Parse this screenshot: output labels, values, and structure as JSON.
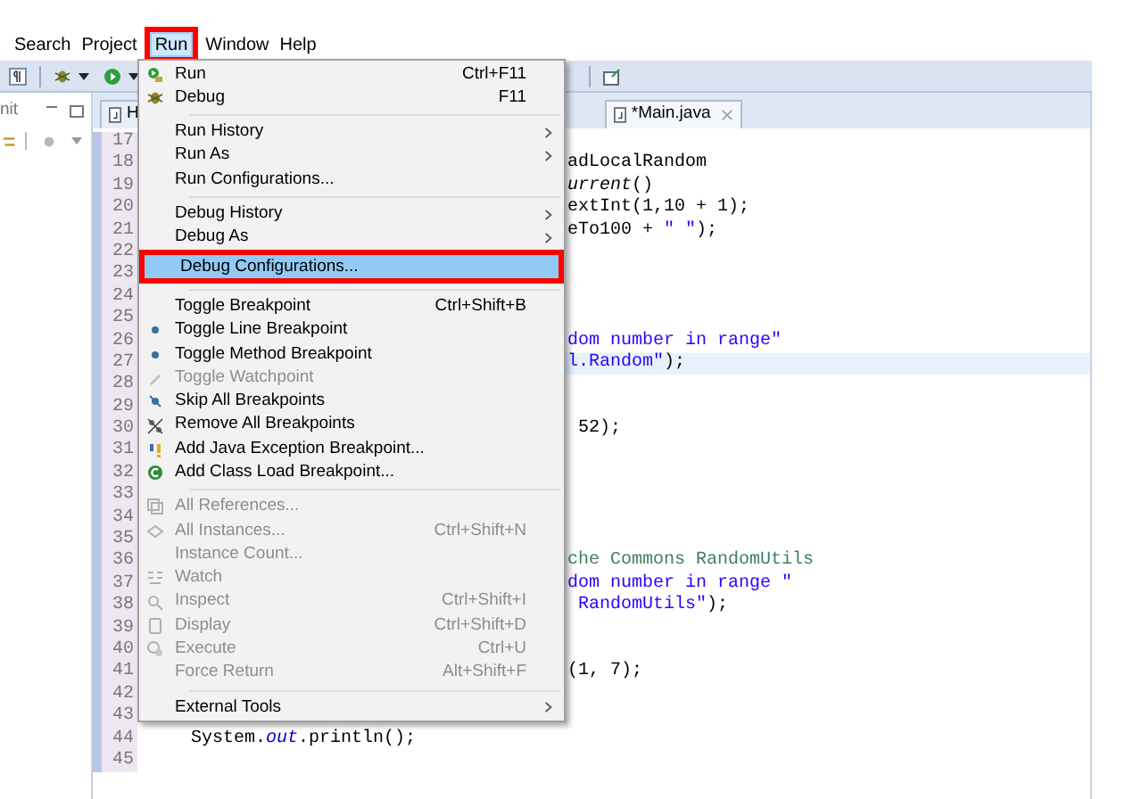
{
  "menu_bar": [
    {
      "label": "Search",
      "selected": false,
      "annotated": false
    },
    {
      "label": "Project",
      "selected": false,
      "annotated": false
    },
    {
      "label": "Run",
      "selected": true,
      "annotated": true
    },
    {
      "label": "Window",
      "selected": false,
      "annotated": false
    },
    {
      "label": "Help",
      "selected": false,
      "annotated": false
    }
  ],
  "left_panel": {
    "tab": "nit"
  },
  "editor": {
    "tabs": [
      {
        "label": "H",
        "selected": false
      },
      {
        "label": "*Main.java",
        "selected": true
      }
    ],
    "lines": [
      {
        "number": "17",
        "current": false
      },
      {
        "number": "18",
        "kind": "partial",
        "current": false,
        "segments": [
          {
            "text": "adLocalRandom",
            "kind": "plain"
          }
        ]
      },
      {
        "number": "19",
        "kind": "partial",
        "current": false,
        "segments": [
          {
            "text": "urrent",
            "kind": "method"
          },
          {
            "text": "()",
            "kind": "plain"
          }
        ]
      },
      {
        "number": "20",
        "kind": "partial",
        "current": false,
        "segments": [
          {
            "text": "extInt(1,10 + 1);",
            "kind": "plain"
          }
        ]
      },
      {
        "number": "21",
        "kind": "partial",
        "current": false,
        "segments": [
          {
            "text": "eTo100 + ",
            "kind": "plain"
          },
          {
            "text": "\" \"",
            "kind": "string"
          },
          {
            "text": ");",
            "kind": "plain"
          }
        ]
      },
      {
        "number": "22",
        "current": false
      },
      {
        "number": "23",
        "current": false
      },
      {
        "number": "24",
        "current": false
      },
      {
        "number": "25",
        "current": false
      },
      {
        "number": "26",
        "kind": "partial",
        "current": false,
        "segments": [
          {
            "text": "dom number in range\"",
            "kind": "string"
          }
        ]
      },
      {
        "number": "27",
        "kind": "partial",
        "current": true,
        "segments": [
          {
            "text": "l.Random\"",
            "kind": "string"
          },
          {
            "text": ");",
            "kind": "plain"
          }
        ]
      },
      {
        "number": "28",
        "current": false
      },
      {
        "number": "29",
        "current": false
      },
      {
        "number": "30",
        "kind": "partial",
        "current": false,
        "segments": [
          {
            "text": " 52);",
            "kind": "plain"
          }
        ]
      },
      {
        "number": "31",
        "current": false
      },
      {
        "number": "32",
        "current": false
      },
      {
        "number": "33",
        "current": false
      },
      {
        "number": "34",
        "current": false
      },
      {
        "number": "35",
        "current": false
      },
      {
        "number": "36",
        "kind": "partial",
        "current": false,
        "segments": [
          {
            "text": "che Commons RandomUtils",
            "kind": "comment"
          }
        ]
      },
      {
        "number": "37",
        "kind": "partial",
        "current": false,
        "segments": [
          {
            "text": "dom number in range \"",
            "kind": "string"
          }
        ]
      },
      {
        "number": "38",
        "kind": "partial",
        "current": false,
        "segments": [
          {
            "text": " RandomUtils\"",
            "kind": "string"
          },
          {
            "text": ");",
            "kind": "plain"
          }
        ]
      },
      {
        "number": "39",
        "current": false
      },
      {
        "number": "40",
        "current": false
      },
      {
        "number": "41",
        "kind": "partial",
        "current": false,
        "segments": [
          {
            "text": "(1, 7);",
            "kind": "plain"
          }
        ]
      },
      {
        "number": "42",
        "current": false
      },
      {
        "number": "43",
        "current": false
      },
      {
        "number": "44",
        "kind": "full",
        "current": false,
        "segments": [
          {
            "text": "System.",
            "kind": "plain"
          },
          {
            "text": "out",
            "kind": "field"
          },
          {
            "text": ".println();",
            "kind": "plain"
          }
        ]
      },
      {
        "number": "45",
        "current": false
      }
    ]
  },
  "run_menu": [
    {
      "kind": "item",
      "label": "Run",
      "shortcut": "Ctrl+F11",
      "submenu": false,
      "disabled": false,
      "selected": false,
      "annotated": false
    },
    {
      "kind": "item",
      "label": "Debug",
      "shortcut": "F11",
      "submenu": false,
      "disabled": false,
      "selected": false,
      "annotated": false
    },
    {
      "kind": "separator"
    },
    {
      "kind": "item",
      "label": "Run History",
      "submenu": true,
      "disabled": false,
      "selected": false,
      "annotated": false
    },
    {
      "kind": "item",
      "label": "Run As",
      "submenu": true,
      "disabled": false,
      "selected": false,
      "annotated": false
    },
    {
      "kind": "item",
      "label": "Run Configurations...",
      "submenu": false,
      "disabled": false,
      "selected": false,
      "annotated": false
    },
    {
      "kind": "separator"
    },
    {
      "kind": "item",
      "label": "Debug History",
      "submenu": true,
      "disabled": false,
      "selected": false,
      "annotated": false
    },
    {
      "kind": "item",
      "label": "Debug As",
      "submenu": true,
      "disabled": false,
      "selected": false,
      "annotated": false
    },
    {
      "kind": "item",
      "label": "Debug Configurations...",
      "submenu": false,
      "disabled": false,
      "selected": true,
      "annotated": true
    },
    {
      "kind": "separator"
    },
    {
      "kind": "item",
      "label": "Toggle Breakpoint",
      "shortcut": "Ctrl+Shift+B",
      "submenu": false,
      "disabled": false,
      "selected": false,
      "annotated": false
    },
    {
      "kind": "item",
      "label": "Toggle Line Breakpoint",
      "submenu": false,
      "disabled": false,
      "selected": false,
      "annotated": false
    },
    {
      "kind": "item",
      "label": "Toggle Method Breakpoint",
      "submenu": false,
      "disabled": false,
      "selected": false,
      "annotated": false
    },
    {
      "kind": "item",
      "label": "Toggle Watchpoint",
      "submenu": false,
      "disabled": true,
      "selected": false,
      "annotated": false
    },
    {
      "kind": "item",
      "label": "Skip All Breakpoints",
      "submenu": false,
      "disabled": false,
      "selected": false,
      "annotated": false
    },
    {
      "kind": "item",
      "label": "Remove All Breakpoints",
      "submenu": false,
      "disabled": false,
      "selected": false,
      "annotated": false
    },
    {
      "kind": "item",
      "label": "Add Java Exception Breakpoint...",
      "submenu": false,
      "disabled": false,
      "selected": false,
      "annotated": false
    },
    {
      "kind": "item",
      "label": "Add Class Load Breakpoint...",
      "submenu": false,
      "disabled": false,
      "selected": false,
      "annotated": false
    },
    {
      "kind": "separator"
    },
    {
      "kind": "item",
      "label": "All References...",
      "submenu": false,
      "disabled": true,
      "selected": false,
      "annotated": false
    },
    {
      "kind": "item",
      "label": "All Instances...",
      "shortcut": "Ctrl+Shift+N",
      "submenu": false,
      "disabled": true,
      "selected": false,
      "annotated": false
    },
    {
      "kind": "item",
      "label": "Instance Count...",
      "submenu": false,
      "disabled": true,
      "selected": false,
      "annotated": false
    },
    {
      "kind": "item",
      "label": "Watch",
      "submenu": false,
      "disabled": true,
      "selected": false,
      "annotated": false
    },
    {
      "kind": "item",
      "label": "Inspect",
      "shortcut": "Ctrl+Shift+I",
      "submenu": false,
      "disabled": true,
      "selected": false,
      "annotated": false
    },
    {
      "kind": "item",
      "label": "Display",
      "shortcut": "Ctrl+Shift+D",
      "submenu": false,
      "disabled": true,
      "selected": false,
      "annotated": false
    },
    {
      "kind": "item",
      "label": "Execute",
      "shortcut": "Ctrl+U",
      "submenu": false,
      "disabled": true,
      "selected": false,
      "annotated": false
    },
    {
      "kind": "item",
      "label": "Force Return",
      "shortcut": "Alt+Shift+F",
      "submenu": false,
      "disabled": true,
      "selected": false,
      "annotated": false
    },
    {
      "kind": "separator"
    },
    {
      "kind": "item",
      "label": "External Tools",
      "submenu": true,
      "disabled": false,
      "selected": false,
      "annotated": false
    }
  ]
}
